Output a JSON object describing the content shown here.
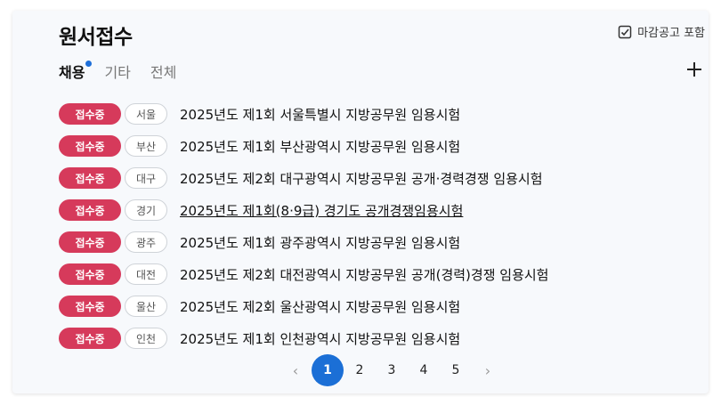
{
  "header": {
    "title": "원서접수",
    "deadline_toggle": "마감공고 포함"
  },
  "tabs": [
    {
      "label": "채용",
      "active": true,
      "has_new": true
    },
    {
      "label": "기타",
      "active": false
    },
    {
      "label": "전체",
      "active": false
    }
  ],
  "icons": {
    "checkbox": "checkbox-checked-icon",
    "add": "plus-icon"
  },
  "colors": {
    "status_badge": "#d63a5b",
    "accent": "#1b6fd6"
  },
  "exams": [
    {
      "status": "접수중",
      "region": "서울",
      "title": "2025년도 제1회 서울특별시 지방공무원 임용시험"
    },
    {
      "status": "접수중",
      "region": "부산",
      "title": "2025년도 제1회 부산광역시 지방공무원 임용시험"
    },
    {
      "status": "접수중",
      "region": "대구",
      "title": "2025년도 제2회 대구광역시 지방공무원 공개·경력경쟁 임용시험"
    },
    {
      "status": "접수중",
      "region": "경기",
      "title": "2025년도 제1회(8·9급) 경기도 공개경쟁임용시험",
      "underlined": true
    },
    {
      "status": "접수중",
      "region": "광주",
      "title": "2025년도 제1회 광주광역시 지방공무원 임용시험"
    },
    {
      "status": "접수중",
      "region": "대전",
      "title": "2025년도 제2회 대전광역시 지방공무원 공개(경력)경쟁 임용시험"
    },
    {
      "status": "접수중",
      "region": "울산",
      "title": "2025년도 제2회 울산광역시 지방공무원 임용시험"
    },
    {
      "status": "접수중",
      "region": "인천",
      "title": "2025년도 제1회 인천광역시 지방공무원 임용시험"
    }
  ],
  "pagination": {
    "prev": "‹",
    "next": "›",
    "pages": [
      "1",
      "2",
      "3",
      "4",
      "5"
    ],
    "current": "1"
  }
}
